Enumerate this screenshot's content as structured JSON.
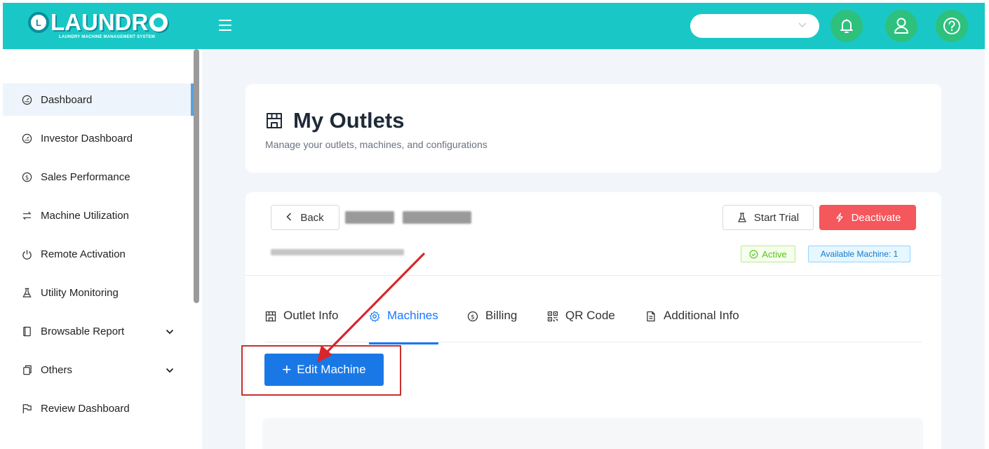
{
  "app": {
    "logo_text": "LAUNDR",
    "logo_mark": "L",
    "logo_subtitle": "LAUNDRY MACHINE MANAGEMENT SYSTEM"
  },
  "topbar": {
    "icons": [
      "menu-icon",
      "bell-icon",
      "user-icon",
      "help-icon"
    ],
    "accent_color": "#19c8c6",
    "circle_color": "#2ec07d"
  },
  "sidebar": {
    "items": [
      {
        "label": "Dashboard",
        "icon": "dashboard-gauge-icon",
        "active": true
      },
      {
        "label": "Investor Dashboard",
        "icon": "dashboard-gauge-icon"
      },
      {
        "label": "Sales Performance",
        "icon": "dollar-circle-icon"
      },
      {
        "label": "Machine Utilization",
        "icon": "swap-icon"
      },
      {
        "label": "Remote Activation",
        "icon": "power-icon"
      },
      {
        "label": "Utility Monitoring",
        "icon": "flask-icon"
      },
      {
        "label": "Browsable Report",
        "icon": "report-icon",
        "expandable": true
      },
      {
        "label": "Others",
        "icon": "copy-icon",
        "expandable": true
      },
      {
        "label": "Review Dashboard",
        "icon": "flag-icon"
      }
    ]
  },
  "header": {
    "title": "My Outlets",
    "subtitle": "Manage your outlets, machines, and configurations"
  },
  "outlet": {
    "back_label": "Back",
    "start_trial_label": "Start Trial",
    "deactivate_label": "Deactivate",
    "status_label": "Active",
    "available_label": "Available Machine: 1"
  },
  "tabs": [
    {
      "label": "Outlet Info",
      "icon": "shop-icon"
    },
    {
      "label": "Machines",
      "icon": "gear-icon",
      "active": true
    },
    {
      "label": "Billing",
      "icon": "dollar-circle-icon"
    },
    {
      "label": "QR Code",
      "icon": "qrcode-icon"
    },
    {
      "label": "Additional Info",
      "icon": "file-icon"
    }
  ],
  "actions": {
    "edit_machine_label": "Edit Machine"
  },
  "colors": {
    "primary": "#1a78e6",
    "danger": "#f4575c",
    "success": "#52c41a",
    "annotation": "#c9302c"
  }
}
